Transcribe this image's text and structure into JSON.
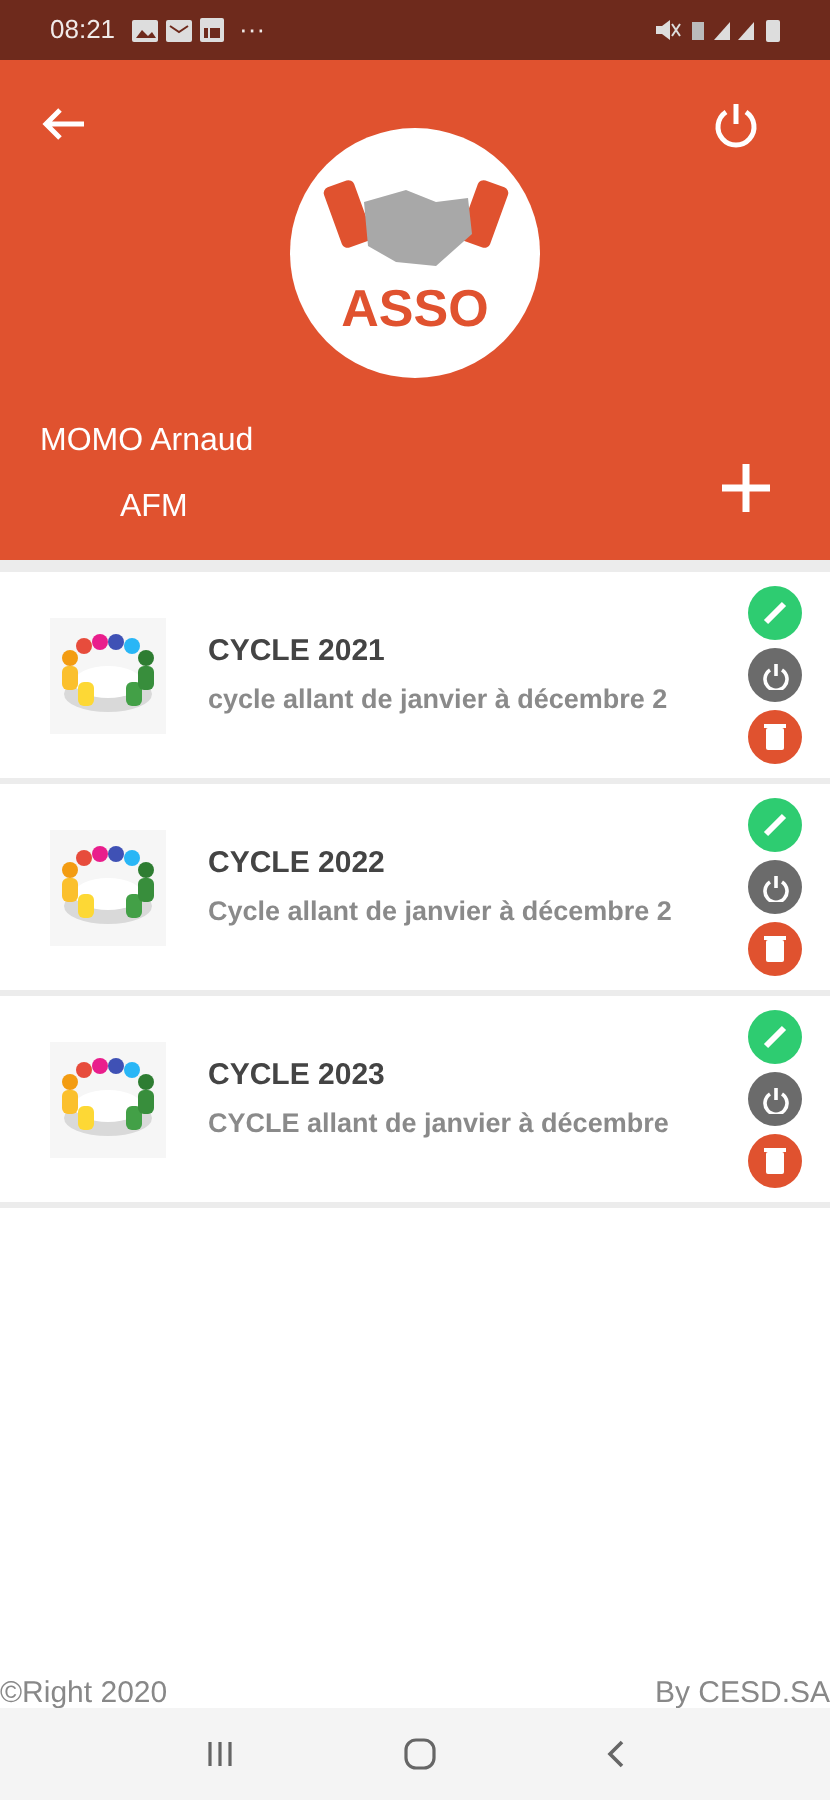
{
  "status_bar": {
    "time": "08:21",
    "more": "···"
  },
  "header": {
    "user_name": "MOMO Arnaud",
    "organization": "AFM",
    "logo_text": "ASSO"
  },
  "cycles": [
    {
      "title": "CYCLE 2021",
      "description": "cycle allant de janvier à décembre 2"
    },
    {
      "title": "CYCLE 2022",
      "description": "Cycle allant de janvier à décembre 2"
    },
    {
      "title": "CYCLE 2023",
      "description": "CYCLE allant de janvier à décembre"
    }
  ],
  "footer": {
    "left": "©Right 2020",
    "right": "By CESD.SA"
  }
}
